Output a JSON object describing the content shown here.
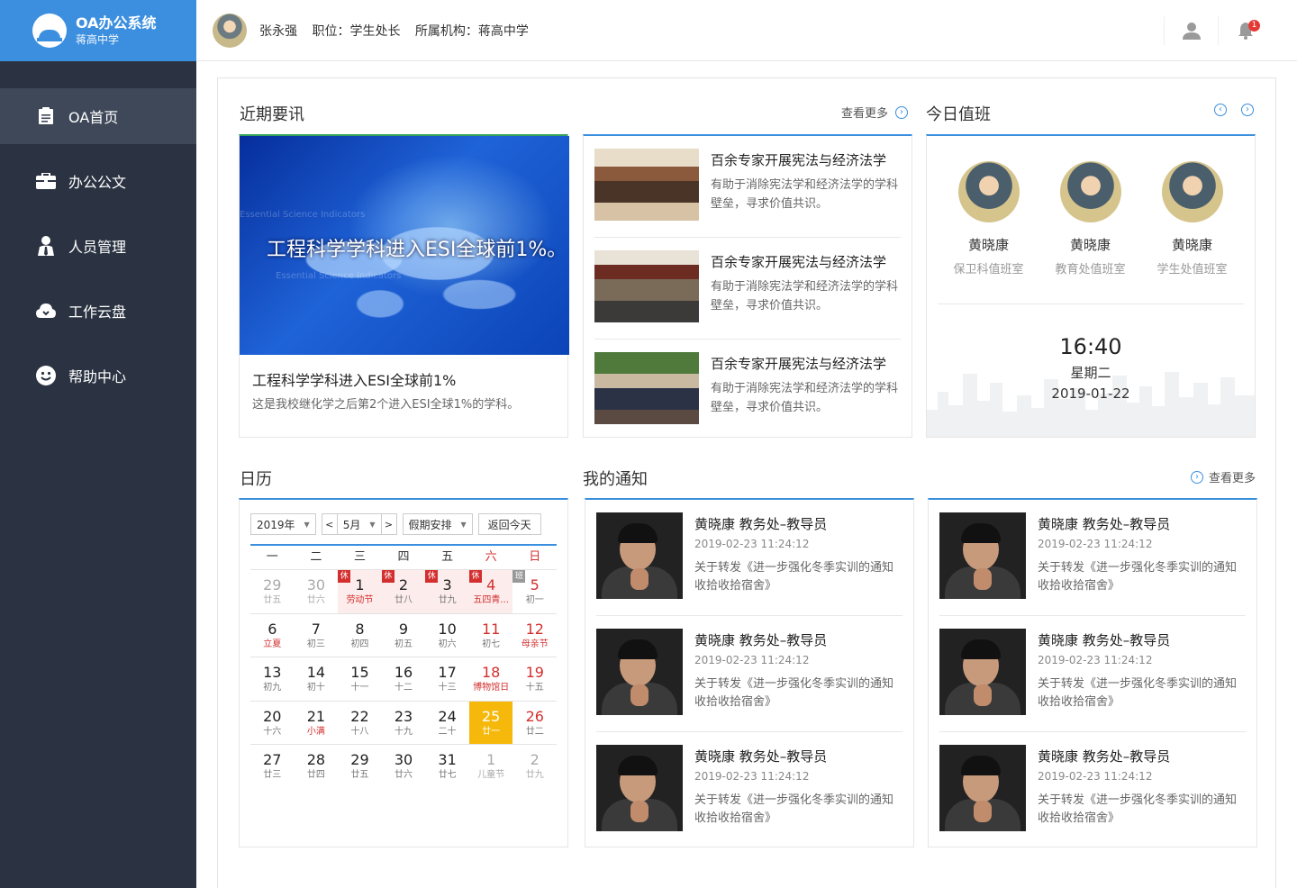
{
  "app": {
    "title": "OA办公系统",
    "subtitle": "蒋高中学"
  },
  "sidebar": {
    "items": [
      {
        "label": "OA首页",
        "icon": "clipboard-icon",
        "active": true
      },
      {
        "label": "办公公文",
        "icon": "briefcase-icon"
      },
      {
        "label": "人员管理",
        "icon": "person-icon"
      },
      {
        "label": "工作云盘",
        "icon": "cloud-icon"
      },
      {
        "label": "帮助中心",
        "icon": "smile-icon"
      }
    ]
  },
  "user": {
    "name": "张永强",
    "position": "职位：学生处长",
    "org": "所属机构：蒋高中学",
    "notifications": "1"
  },
  "news": {
    "title": "近期要讯",
    "more": "查看更多",
    "featured": {
      "image_text": "工程科学学科进入ESI全球前1%。",
      "watermark": "Essential Science Indicators",
      "title": "工程科学学科进入ESI全球前1%",
      "desc": "这是我校继化学之后第2个进入ESI全球1%的学科。"
    },
    "items": [
      {
        "title": "百余专家开展宪法与经济法学",
        "desc": "有助于消除宪法学和经济法学的学科壁垒，寻求价值共识。"
      },
      {
        "title": "百余专家开展宪法与经济法学",
        "desc": "有助于消除宪法学和经济法学的学科壁垒，寻求价值共识。"
      },
      {
        "title": "百余专家开展宪法与经济法学",
        "desc": "有助于消除宪法学和经济法学的学科壁垒，寻求价值共识。"
      }
    ]
  },
  "duty": {
    "title": "今日值班",
    "people": [
      {
        "name": "黄晓康",
        "dept": "保卫科值班室"
      },
      {
        "name": "黄晓康",
        "dept": "教育处值班室"
      },
      {
        "name": "黄晓康",
        "dept": "学生处值班室"
      }
    ],
    "time": "16:40",
    "weekday": "星期二",
    "date": "2019-01-22"
  },
  "calendar": {
    "title": "日历",
    "year": "2019年",
    "month": "5月",
    "holiday_select": "假期安排",
    "today_button": "返回今天",
    "weekdays": [
      "一",
      "二",
      "三",
      "四",
      "五",
      "六",
      "日"
    ],
    "rows": [
      [
        {
          "d": "29",
          "l": "廿五",
          "other": true
        },
        {
          "d": "30",
          "l": "廿六",
          "other": true
        },
        {
          "d": "1",
          "l": "劳动节",
          "tag": "休",
          "hol": true,
          "red": true
        },
        {
          "d": "2",
          "l": "廿八",
          "tag": "休",
          "hol": true
        },
        {
          "d": "3",
          "l": "廿九",
          "tag": "休",
          "hol": true
        },
        {
          "d": "4",
          "l": "五四青...",
          "tag": "休",
          "hol": true,
          "we": true,
          "red": true
        },
        {
          "d": "5",
          "l": "初一",
          "tag": "班",
          "we": true,
          "ban": true
        }
      ],
      [
        {
          "d": "6",
          "l": "立夏",
          "red": true
        },
        {
          "d": "7",
          "l": "初三"
        },
        {
          "d": "8",
          "l": "初四"
        },
        {
          "d": "9",
          "l": "初五"
        },
        {
          "d": "10",
          "l": "初六"
        },
        {
          "d": "11",
          "l": "初七",
          "we": true
        },
        {
          "d": "12",
          "l": "母亲节",
          "we": true,
          "red": true
        }
      ],
      [
        {
          "d": "13",
          "l": "初九"
        },
        {
          "d": "14",
          "l": "初十"
        },
        {
          "d": "15",
          "l": "十一"
        },
        {
          "d": "16",
          "l": "十二"
        },
        {
          "d": "17",
          "l": "十三"
        },
        {
          "d": "18",
          "l": "博物馆日",
          "we": true,
          "red": true
        },
        {
          "d": "19",
          "l": "十五",
          "we": true
        }
      ],
      [
        {
          "d": "20",
          "l": "十六"
        },
        {
          "d": "21",
          "l": "小满",
          "red": true
        },
        {
          "d": "22",
          "l": "十八"
        },
        {
          "d": "23",
          "l": "十九"
        },
        {
          "d": "24",
          "l": "二十"
        },
        {
          "d": "25",
          "l": "廿一",
          "today": true
        },
        {
          "d": "26",
          "l": "廿二",
          "we": true
        }
      ],
      [
        {
          "d": "27",
          "l": "廿三"
        },
        {
          "d": "28",
          "l": "廿四"
        },
        {
          "d": "29",
          "l": "廿五"
        },
        {
          "d": "30",
          "l": "廿六"
        },
        {
          "d": "31",
          "l": "廿七"
        },
        {
          "d": "1",
          "l": "儿童节",
          "other": true
        },
        {
          "d": "2",
          "l": "廿九",
          "other": true
        }
      ]
    ]
  },
  "notices": {
    "title": "我的通知",
    "more": "查看更多",
    "left": [
      {
        "title": "黄晓康 教务处–教导员",
        "time": "2019-02-23 11:24:12",
        "text": "关于转发《进一步强化冬季实训的通知收拾收拾宿舍》"
      },
      {
        "title": "黄晓康 教务处–教导员",
        "time": "2019-02-23 11:24:12",
        "text": "关于转发《进一步强化冬季实训的通知收拾收拾宿舍》"
      },
      {
        "title": "黄晓康 教务处–教导员",
        "time": "2019-02-23 11:24:12",
        "text": "关于转发《进一步强化冬季实训的通知收拾收拾宿舍》"
      }
    ],
    "right": [
      {
        "title": "黄晓康 教务处–教导员",
        "time": "2019-02-23 11:24:12",
        "text": "关于转发《进一步强化冬季实训的通知收拾收拾宿舍》"
      },
      {
        "title": "黄晓康 教务处–教导员",
        "time": "2019-02-23 11:24:12",
        "text": "关于转发《进一步强化冬季实训的通知收拾收拾宿舍》"
      },
      {
        "title": "黄晓康 教务处–教导员",
        "time": "2019-02-23 11:24:12",
        "text": "关于转发《进一步强化冬季实训的通知收拾收拾宿舍》"
      }
    ]
  },
  "colors": {
    "brand": "#3c8fdf",
    "sidebar": "#2b3342",
    "sidebar_active": "#3f4859",
    "today": "#f6b90b",
    "holiday_red": "#d32f2f"
  }
}
